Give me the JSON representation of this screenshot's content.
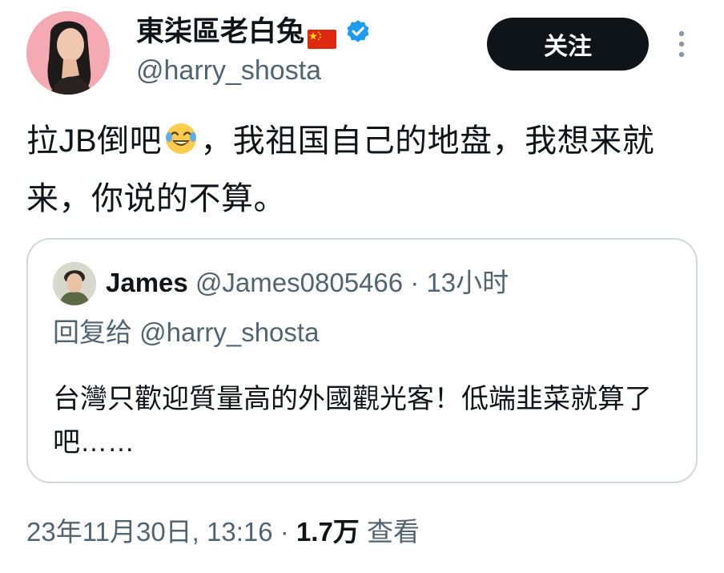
{
  "author": {
    "display_name": "東柒區老白兔",
    "flag_icon": "china-flag-icon",
    "verified_icon": "verified-badge-icon",
    "handle": "@harry_shosta"
  },
  "actions": {
    "follow_label": "关注",
    "more_icon": "more-vertical-icon"
  },
  "tweet": {
    "text_before_emoji": "拉JB倒吧",
    "emoji": "face-with-tears-of-joy-emoji",
    "text_after_emoji": "，我祖国自己的地盘，我想来就来，你说的不算。"
  },
  "quote": {
    "name": "James",
    "handle": "@James0805466",
    "separator": "·",
    "time": "13小时",
    "reply_prefix": "回复给",
    "reply_to": "@harry_shosta",
    "text": "台灣只歡迎質量高的外國觀光客！低端韭菜就算了吧……"
  },
  "footer": {
    "timestamp": "23年11月30日, 13:16",
    "separator": "·",
    "views_count": "1.7万",
    "views_label": "查看"
  },
  "colors": {
    "text_primary": "#0f1419",
    "text_secondary": "#536471",
    "border": "#cfd9de",
    "verified_blue": "#1d9bf0",
    "follow_bg": "#0f1419"
  }
}
